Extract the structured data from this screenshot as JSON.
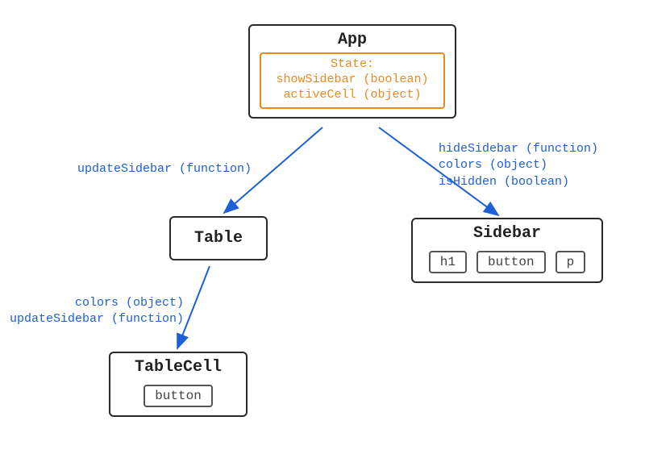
{
  "nodes": {
    "app": {
      "title": "App",
      "state_heading": "State:",
      "state_line1": "showSidebar (boolean)",
      "state_line2": "activeCell (object)"
    },
    "table": {
      "title": "Table"
    },
    "tablecell": {
      "title": "TableCell",
      "children": {
        "button": "button"
      }
    },
    "sidebar": {
      "title": "Sidebar",
      "children": {
        "h1": "h1",
        "button": "button",
        "p": "p"
      }
    }
  },
  "edges": {
    "app_to_table": {
      "label": "updateSidebar (function)"
    },
    "app_to_sidebar": {
      "line1": "hideSidebar (function)",
      "line2": "colors (object)",
      "line3": "isHidden (boolean)"
    },
    "table_to_tablecell": {
      "line1": "colors (object)",
      "line2": "updateSidebar (function)"
    }
  },
  "colors": {
    "node_border": "#2a2a2a",
    "state_border": "#e98a1f",
    "edge": "#1d5fd6"
  }
}
